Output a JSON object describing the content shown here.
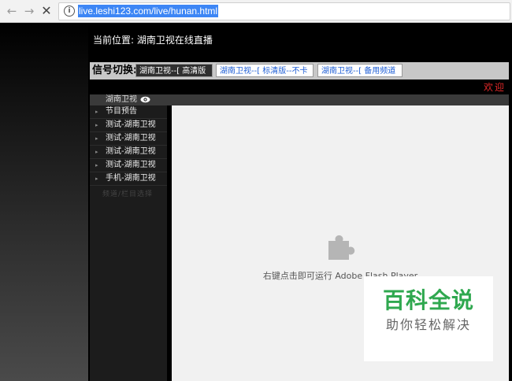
{
  "browser": {
    "url": "live.leshi123.com/live/hunan.html",
    "back_icon": "←",
    "forward_icon": "→",
    "stop_icon": "✕",
    "info_icon": "i"
  },
  "page": {
    "location": "当前位置: 湖南卫视在线直播",
    "signal": {
      "label": "信号切换:",
      "options": [
        "湖南卫视--[ 高清版 ]",
        "湖南卫视--[ 标清版--不卡 ]",
        "湖南卫视--[ 备用频道 ]"
      ]
    },
    "welcome": "欢迎",
    "channel_title": "湖南卫视",
    "sidebar_items": [
      "节目预告",
      "测试-湖南卫视",
      "测试-湖南卫视",
      "测试-湖南卫视",
      "测试-湖南卫视",
      "手机-湖南卫视"
    ],
    "sidebar_footer": "频道/栏目选择",
    "flash_message": "右键点击即可运行 Adobe Flash Player"
  },
  "watermark": {
    "title": "百科全说",
    "subtitle": "助你轻松解决"
  },
  "colors": {
    "url_highlight": "#3d86f5",
    "welcome": "#e02828",
    "watermark_green": "#2fa84f",
    "link_blue": "#1f5fd6"
  }
}
